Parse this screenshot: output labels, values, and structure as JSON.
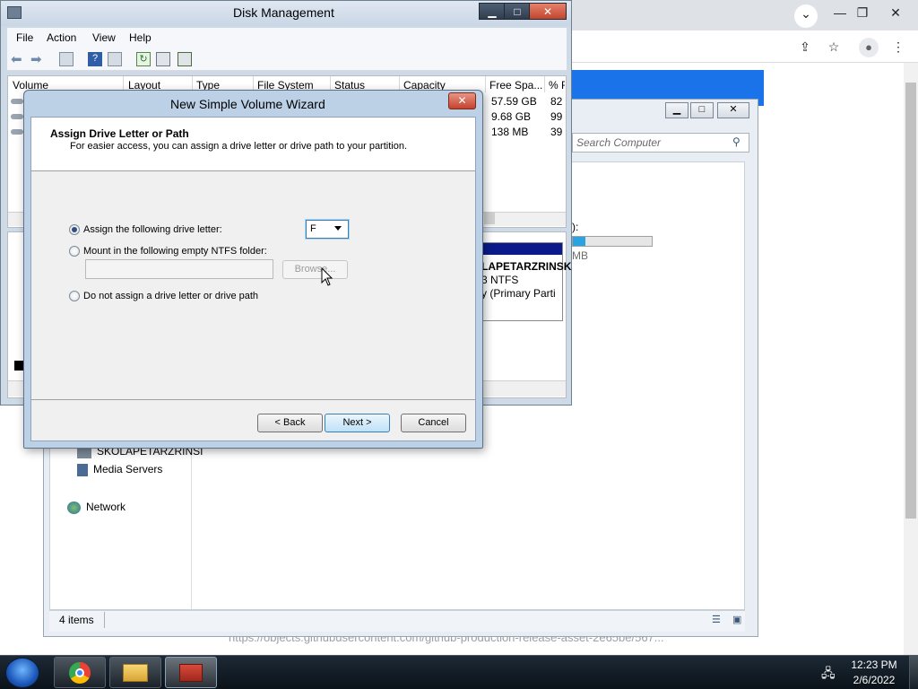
{
  "disk_management": {
    "title": "Disk Management",
    "menu": [
      "File",
      "Action",
      "View",
      "Help"
    ],
    "columns": [
      "Volume",
      "Layout",
      "Type",
      "File System",
      "Status",
      "Capacity",
      "Free Spa...",
      "% F"
    ],
    "rows": [
      {
        "free": "57.59 GB",
        "pct": "82"
      },
      {
        "free": "9.68 GB",
        "pct": "99"
      },
      {
        "free": "138 MB",
        "pct": "39"
      }
    ],
    "partition": {
      "name": "LAPETARZRINSK",
      "fs": "3 NTFS",
      "status": "y (Primary Parti"
    }
  },
  "wizard": {
    "title": "New Simple Volume Wizard",
    "heading": "Assign Drive Letter or Path",
    "subheading": "For easier access, you can assign a drive letter or drive path to your partition.",
    "options": {
      "assign_letter": "Assign the following drive letter:",
      "mount_folder": "Mount in the following empty NTFS folder:",
      "no_assign": "Do not assign a drive letter or drive path"
    },
    "selected_option": "assign_letter",
    "drive_letter": "F",
    "browse_label": "Browse...",
    "buttons": {
      "back": "< Back",
      "next": "Next >",
      "cancel": "Cancel"
    }
  },
  "explorer": {
    "search_placeholder": "Search Computer",
    "nav": {
      "computer_name": "SKOLAPETARZRINSI",
      "media_servers": "Media Servers",
      "network": "Network"
    },
    "status_items": "4 items",
    "drive_partial_label": "):",
    "drive_partial_size": "MB"
  },
  "browser": {
    "status_url": "https://objects.githubusercontent.com/github-production-release-asset-2e65be/567..."
  },
  "taskbar": {
    "time": "12:23 PM",
    "date": "2/6/2022"
  },
  "colors": {
    "chrome_header": "#1a73e8",
    "partition_header": "#0a1a8a",
    "taskbar": "#0b1219"
  }
}
